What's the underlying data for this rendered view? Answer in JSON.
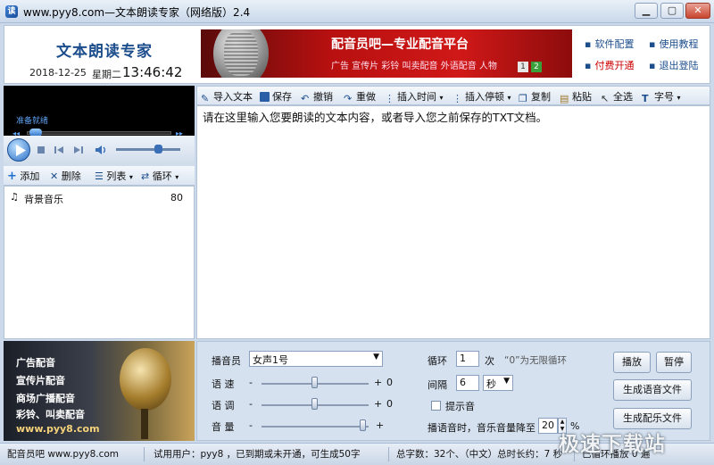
{
  "window": {
    "title": "www.pyy8.com—文本朗读专家（网络版）2.4",
    "icon": "app-icon"
  },
  "header": {
    "app_title": "文本朗读专家",
    "date": "2018-12-25",
    "weekday": "星期二",
    "time": "13:46:42",
    "banner_title": "配音员吧—专业配音平台",
    "banner_subtitle": "广告  宣传片  彩铃  叫卖配音  外语配音  人物",
    "banner_pages": [
      "1",
      "2"
    ],
    "links": {
      "software_config": "软件配置",
      "tutorial": "使用教程",
      "paid_activation": "付费开通",
      "logout": "退出登陆"
    }
  },
  "player": {
    "status": "准备就绪",
    "progress": 0.02,
    "volume": 0.65
  },
  "playlist": {
    "toolbar": {
      "add": "添加",
      "delete": "删除",
      "list": "列表",
      "loop": "循环"
    },
    "items": [
      {
        "name": "背景音乐",
        "value": "80"
      }
    ]
  },
  "editor": {
    "toolbar": {
      "import": "导入文本",
      "save": "保存",
      "undo": "撤销",
      "redo": "重做",
      "insert_time": "插入时间",
      "insert_pause": "插入停顿",
      "copy": "复制",
      "paste": "粘贴",
      "select_all": "全选",
      "font_size": "字号"
    },
    "content": "请在这里输入您要朗读的文本内容，或者导入您之前保存的TXT文档。"
  },
  "ad": {
    "lines": [
      "广告配音",
      "宣传片配音",
      "商场广播配音",
      "彩铃、叫卖配音",
      "www.pyy8.com"
    ]
  },
  "settings": {
    "announcer_label": "播音员",
    "announcer_value": "女声1号",
    "speed_label": "语  速",
    "speed_value": "0",
    "speed_level": 0.5,
    "pitch_label": "语  调",
    "pitch_value": "0",
    "pitch_level": 0.5,
    "volume_label": "音  量",
    "volume_level": 0.95,
    "minus": "-",
    "plus": "+",
    "loop_label": "循环",
    "loop_value": "1",
    "loop_unit": "次",
    "loop_hint": "“0”为无限循环",
    "interval_label": "间隔",
    "interval_value": "6",
    "interval_unit": "秒",
    "beep_label": "提示音",
    "duck_label": "播语音时，音乐音量降至",
    "duck_value": "20",
    "duck_unit": "%"
  },
  "buttons": {
    "play": "播放",
    "pause": "暂停",
    "gen_voice": "生成语音文件",
    "gen_music": "生成配乐文件"
  },
  "statusbar": {
    "site": "配音员吧  www.pyy8.com",
    "user": "试用用户：pyy8 ，已到期或未开通，可生成50字",
    "stats": "总字数：32个、（中文）总时长约：7 秒",
    "played": "已循环播放 0 遍"
  },
  "watermark": "极速下载站",
  "colors": {
    "accent": "#1c4d8c",
    "link_red": "#cc0000",
    "panel_bg": "#d5e1ef",
    "banner_red": "#c01414"
  }
}
